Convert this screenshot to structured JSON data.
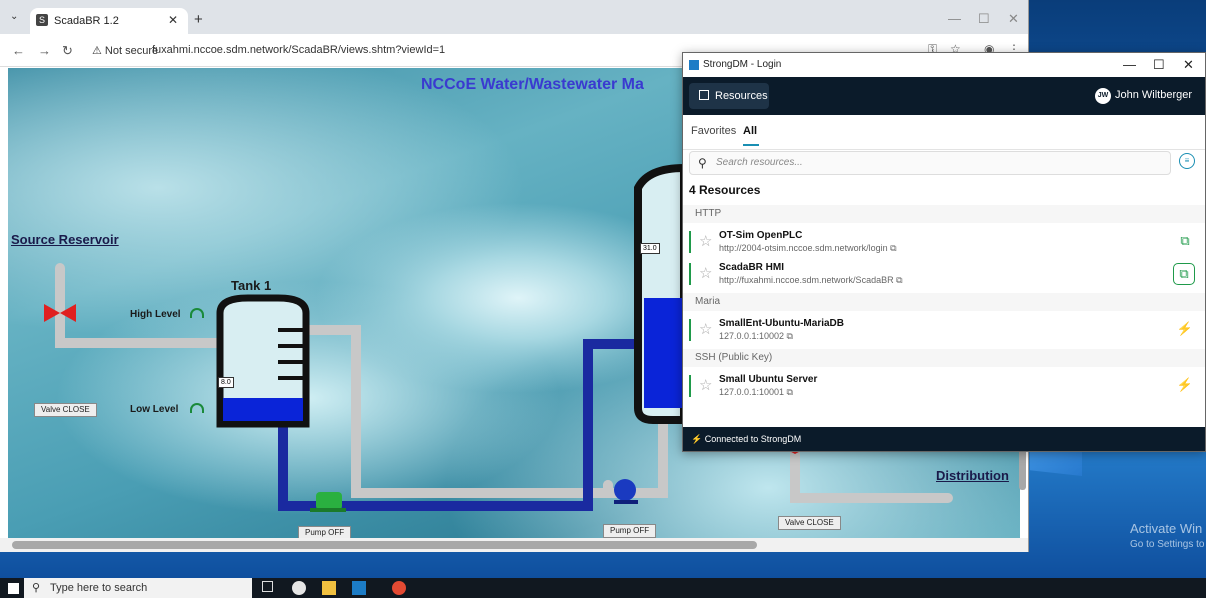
{
  "browser": {
    "tab_title": "ScadaBR 1.2",
    "tab_favicon": "S",
    "not_secure": "Not secure",
    "url": "fuxahmi.nccoe.sdm.network/ScadaBR/views.shtm?viewId=1"
  },
  "scada": {
    "title": "NCCoE Water/Wastewater Ma",
    "source_reservoir": "Source Reservoir",
    "distribution": "Distribution",
    "tank1_label": "Tank 1",
    "high_level": "High Level",
    "low_level": "Low Level",
    "tank1_reading": "8.0",
    "tank2_reading": "31.0",
    "valve1": "Valve CLOSE",
    "valve2": "Valve CLOSE",
    "pump1": "Pump OFF",
    "pump2": "Pump OFF"
  },
  "sdm": {
    "window_title": "StrongDM - Login",
    "resources_button": "Resources",
    "user_initials": "JW",
    "user_name": "John Wiltberger",
    "tab_favorites": "Favorites",
    "tab_all": "All",
    "search_placeholder": "Search resources...",
    "count": "4 Resources",
    "groups": {
      "http": "HTTP",
      "maria": "Maria",
      "ssh": "SSH (Public Key)"
    },
    "items": [
      {
        "name": "OT-Sim OpenPLC",
        "address": "http://2004-otsim.nccoe.sdm.network/login ⧉"
      },
      {
        "name": "ScadaBR HMI",
        "address": "http://fuxahmi.nccoe.sdm.network/ScadaBR ⧉"
      },
      {
        "name": "SmallEnt-Ubuntu-MariaDB",
        "address": "127.0.0.1:10002 ⧉"
      },
      {
        "name": "Small Ubuntu Server",
        "address": "127.0.0.1:10001 ⧉"
      }
    ],
    "footer": "Connected to StrongDM"
  },
  "desktop": {
    "activate_line1": "Activate Win",
    "activate_line2": "Go to Settings to"
  },
  "taskbar": {
    "search_placeholder": "Type here to search"
  }
}
